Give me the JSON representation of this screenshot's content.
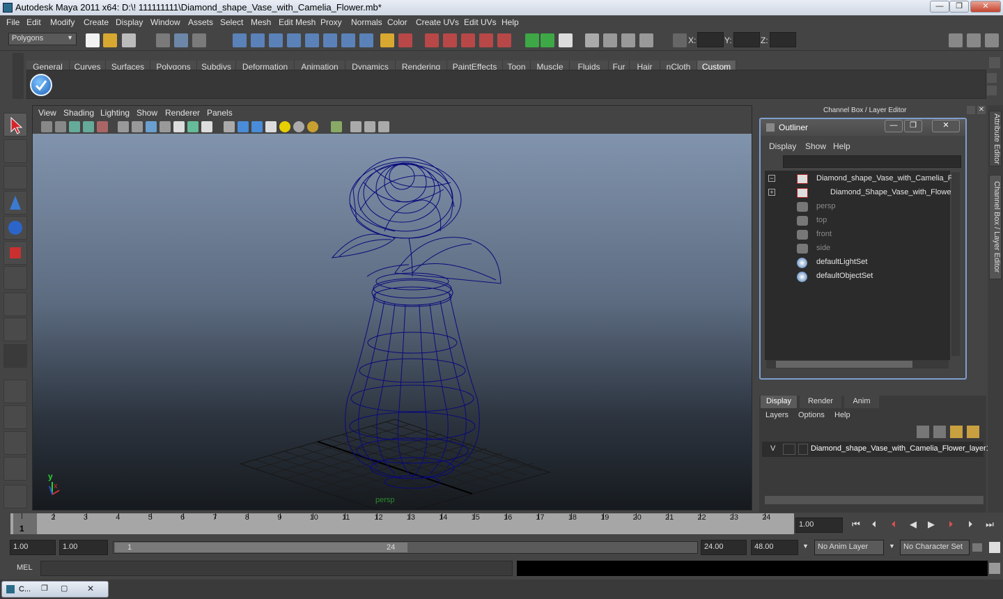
{
  "window": {
    "title": "Autodesk Maya 2011 x64: D:\\! 111111111\\Diamond_shape_Vase_with_Camelia_Flower.mb*"
  },
  "menubar": [
    "File",
    "Edit",
    "Modify",
    "Create",
    "Display",
    "Window",
    "Assets",
    "Select",
    "Mesh",
    "Edit Mesh",
    "Proxy",
    "Normals",
    "Color",
    "Create UVs",
    "Edit UVs",
    "Help"
  ],
  "statusline": {
    "mode": "Polygons",
    "x_label": "X:",
    "y_label": "Y:",
    "z_label": "Z:"
  },
  "shelf": {
    "tabs": [
      "General",
      "Curves",
      "Surfaces",
      "Polygons",
      "Subdivs",
      "Deformation",
      "Animation",
      "Dynamics",
      "Rendering",
      "PaintEffects",
      "Toon",
      "Muscle",
      "Fluids",
      "Fur",
      "Hair",
      "nCloth",
      "Custom"
    ],
    "active": "Custom"
  },
  "viewport": {
    "menus": [
      "View",
      "Shading",
      "Lighting",
      "Show",
      "Renderer",
      "Panels"
    ],
    "camera_label": "persp",
    "axis_x": "x",
    "axis_y": "y"
  },
  "channelbox": {
    "header": "Channel Box / Layer Editor"
  },
  "outliner": {
    "title": "Outliner",
    "menus": [
      "Display",
      "Show",
      "Help"
    ],
    "items": [
      {
        "label": "Diamond_shape_Vase_with_Camelia_Flo",
        "dim": false
      },
      {
        "label": "Diamond_Shape_Vase_with_Flower",
        "dim": false
      },
      {
        "label": "persp",
        "dim": true
      },
      {
        "label": "top",
        "dim": true
      },
      {
        "label": "front",
        "dim": true
      },
      {
        "label": "side",
        "dim": true
      },
      {
        "label": "defaultLightSet",
        "dim": false
      },
      {
        "label": "defaultObjectSet",
        "dim": false
      }
    ]
  },
  "sidebar": {
    "attribute_editor": "Attribute Editor",
    "channel_box": "Channel Box / Layer Editor"
  },
  "layer_editor": {
    "tabs": [
      "Display",
      "Render",
      "Anim"
    ],
    "menus": [
      "Layers",
      "Options",
      "Help"
    ],
    "layer": {
      "visibility": "V",
      "name": "Diamond_shape_Vase_with_Camelia_Flower_layer1"
    }
  },
  "timeline": {
    "ticks": [
      "1",
      "2",
      "3",
      "4",
      "5",
      "6",
      "7",
      "8",
      "9",
      "10",
      "11",
      "12",
      "13",
      "14",
      "15",
      "16",
      "17",
      "18",
      "19",
      "20",
      "21",
      "22",
      "23",
      "24"
    ],
    "current_frame_label": "1",
    "current_time": "1.00"
  },
  "range": {
    "start": "1.00",
    "anim_start": "1.00",
    "slider_start": "1",
    "slider_end": "24",
    "anim_end": "24.00",
    "end": "48.00",
    "anim_layer": "No Anim Layer",
    "character_set": "No Character Set"
  },
  "mel": {
    "label": "MEL"
  },
  "taskbar": {
    "label": "C..."
  },
  "colors": {
    "wire": "#0a0a7a",
    "accent": "#7e9fcf"
  }
}
